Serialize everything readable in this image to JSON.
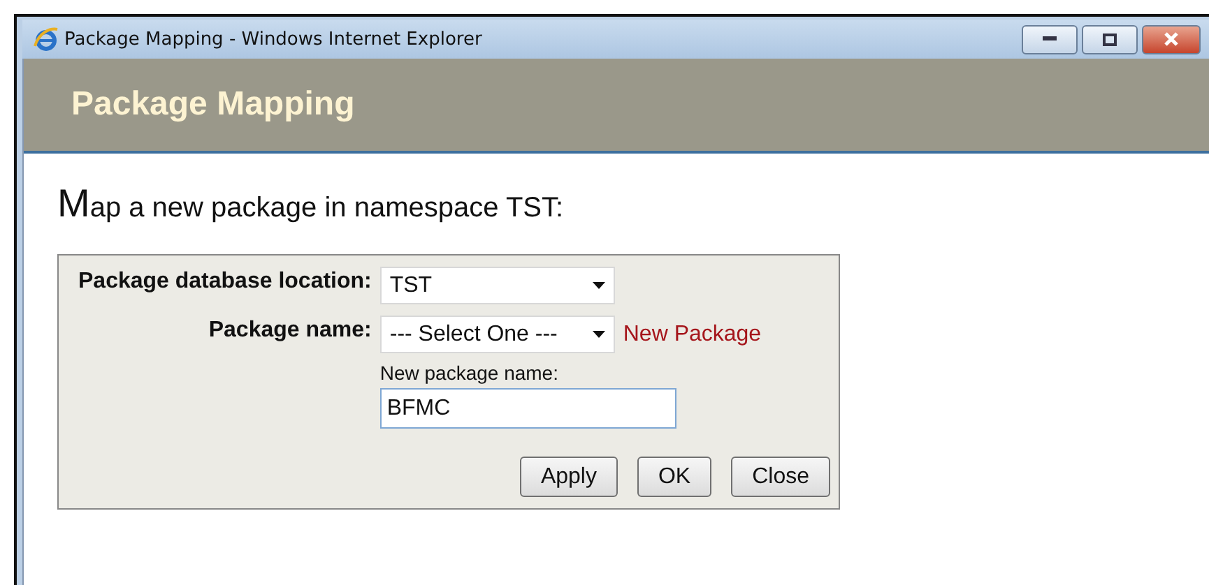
{
  "window": {
    "title": "Package Mapping - Windows Internet Explorer"
  },
  "header": {
    "title": "Package Mapping"
  },
  "heading": "Map a new package in namespace TST:",
  "form": {
    "fields": [
      {
        "label": "Package database location:",
        "value": "TST"
      },
      {
        "label": "Package name:",
        "value": "--- Select One ---"
      }
    ],
    "new_package_link": "New Package",
    "new_name": {
      "label": "New package name:",
      "value": "BFMC"
    },
    "buttons": [
      "Apply",
      "OK",
      "Close"
    ]
  }
}
